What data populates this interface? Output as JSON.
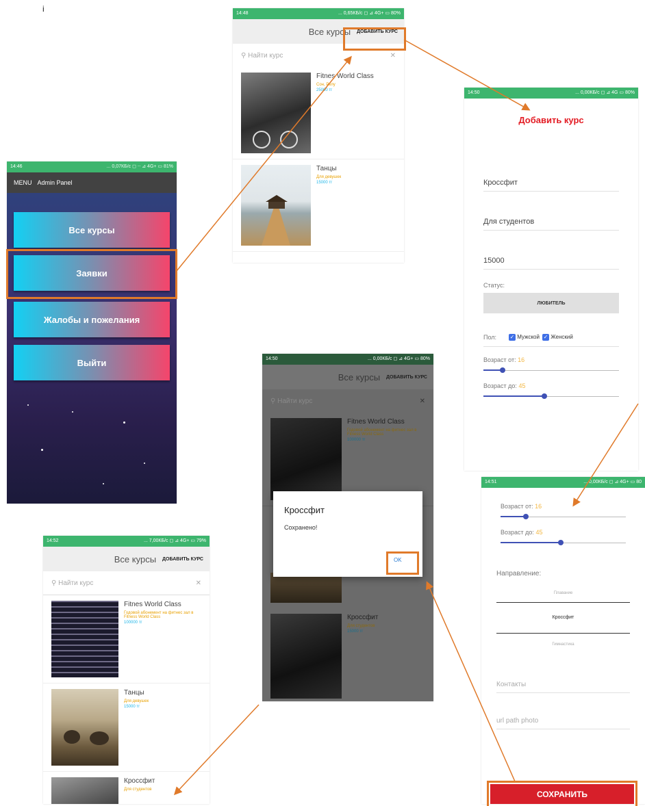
{
  "colors": {
    "accent_orange": "#e07a2a",
    "status_green": "#3db56e",
    "title_red": "#e31b23",
    "save_red": "#d71f2a",
    "price_blue": "#21b6e8"
  },
  "corner_mark": "i",
  "admin": {
    "status_time": "14:46",
    "status_right": "... 0,07КБ/с ◻ ⋅⋅ ⊿ 4G+ ▭ 81%",
    "menu": "MENU",
    "title": "Admin Panel",
    "buttons": [
      "Все курсы",
      "Заявки",
      "Жалобы и пожелания",
      "Выйти"
    ]
  },
  "list_top": {
    "status_time": "14:48",
    "status_right": "... 0,65КБ/с ◻ ⊿ 4G+ ▭ 80%",
    "title": "Все курсы",
    "add_button": "ДОБАВИТЬ КУРС",
    "search_placeholder": "Найти курс",
    "courses": [
      {
        "name": "Fitnes World Class",
        "desc": "Сон, Релу",
        "price": "25000 тг"
      },
      {
        "name": "Танцы",
        "desc": "Для девушек",
        "price": "15000 тг"
      }
    ]
  },
  "add_form": {
    "status_time": "14:50",
    "status_right": "... 0,00КБ/с ◻ ⊿ 4G ▭ 80%",
    "title": "Добавить курс",
    "name_value": "Кроссфит",
    "desc_value": "Для студентов",
    "price_value": "15000",
    "status_label": "Статус:",
    "status_button": "ЛЮБИТЕЛЬ",
    "gender_label": "Пол:",
    "male": "Мужской",
    "female": "Женский",
    "age_from_label": "Возраст от:",
    "age_from_value": "16",
    "age_from_level": 0.14,
    "age_to_label": "Возраст до:",
    "age_to_value": "45",
    "age_to_level": 0.45
  },
  "add_form_scrolled": {
    "status_time": "14:51",
    "status_right": "... 0,00КБ/с ◻ ⊿ 4G+ ▭ 80",
    "age_from_label": "Возраст от:",
    "age_from_value": "16",
    "age_from_level": 0.2,
    "age_to_label": "Возраст до:",
    "age_to_value": "45",
    "age_to_level": 0.48,
    "direction_label": "Направление:",
    "directions": [
      "Плавание",
      "Кроссфит",
      "Гимнастика"
    ],
    "contacts_placeholder": "Контакты",
    "photo_placeholder": "url path photo",
    "save_button": "СОХРАНИТЬ"
  },
  "dialog_screen": {
    "status_time": "14:50",
    "status_right": "... 0,00КБ/с ◻ ⊿ 4G+ ▭ 80%",
    "title": "Все курсы",
    "add_button": "ДОБАВИТЬ КУРС",
    "search_placeholder": "Найти курс",
    "course1_name": "Fitnes World Class",
    "course1_desc": "Годовой абонемент на фитнес зал в Fitness World Class",
    "course1_price": "100000 тг",
    "course2_name": "Кроссфит",
    "course2_desc": "Для студентов",
    "course2_price": "15000 тг",
    "dialog_title": "Кроссфит",
    "dialog_message": "Сохранено!",
    "dialog_ok": "OK"
  },
  "list_bottom": {
    "status_time": "14:52",
    "status_right": "... 7,00КБ/с ◻ ⊿ 4G+ ▭ 79%",
    "title": "Все курсы",
    "add_button": "ДОБАВИТЬ КУРС",
    "search_placeholder": "Найти курс",
    "courses": [
      {
        "name": "Fitnes World Class",
        "desc": "Годовой абонемент на фитнес зал в Fitness World Class",
        "price": "100000 тг"
      },
      {
        "name": "Танцы",
        "desc": "Для девушек",
        "price": "15000 тг"
      },
      {
        "name": "Кроссфит",
        "desc": "Для студентов",
        "price": ""
      }
    ]
  }
}
